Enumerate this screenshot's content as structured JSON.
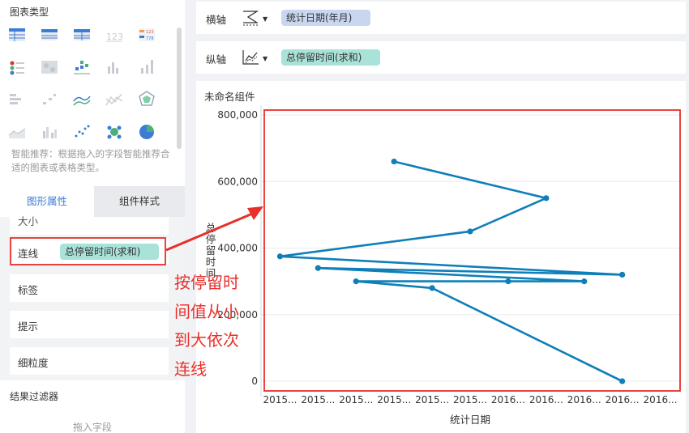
{
  "left_panel": {
    "chart_types_title": "图表类型",
    "chart_types": [
      "table-icon",
      "cross-table-icon",
      "detail-table-icon",
      "number-card-icon",
      "multi-number-icon",
      "indicator-card-icon",
      "heat-map-icon",
      "matrix-icon",
      "column-icon",
      "bar-icon",
      "stacked-bar-icon",
      "scatter-bar-icon",
      "line-icon",
      "area-line-icon",
      "radar-icon",
      "area-icon",
      "grouped-column-icon",
      "scatter-icon",
      "bubble-icon",
      "pie-icon"
    ],
    "hint": "智能推荐：根据拖入的字段智能推荐合适的图表或表格类型。",
    "tabs": [
      "图形属性",
      "组件样式"
    ],
    "size_label": "大小",
    "line_label": "连线",
    "line_field": "总停留时间(求和)",
    "label_label": "标签",
    "tip_label": "提示",
    "granularity_label": "细粒度",
    "filter_title": "结果过滤器",
    "drop_field": "拖入字段"
  },
  "axes": {
    "x_label": "横轴",
    "x_field": "统计日期(年月)",
    "y_label": "纵轴",
    "y_field": "总停留时间(求和)"
  },
  "widget_title": "未命名组件",
  "annotation": "按停留时间值从小到大依次连线",
  "colors": {
    "series": "#0e7fb8",
    "highlight": "#e8302a",
    "active_tab": "#3e7bd5",
    "x_pill": "#c8d6f0",
    "y_pill": "#a9e2d8"
  },
  "chart_data": {
    "type": "line",
    "xlabel": "统计日期",
    "ylabel": "总停留时间",
    "categories": [
      "2015...",
      "2015...",
      "2015...",
      "2015...",
      "2015...",
      "2015...",
      "2016...",
      "2016...",
      "2016...",
      "2016...",
      "2016..."
    ],
    "yticks": [
      "0",
      "200,000",
      "400,000",
      "600,000",
      "800,000"
    ],
    "ylim": [
      0,
      800000
    ],
    "grid": true,
    "points_in_connection_order": [
      {
        "x": 9.5,
        "y": 0
      },
      {
        "x": 4.5,
        "y": 280000
      },
      {
        "x": 2.5,
        "y": 300000
      },
      {
        "x": 6.5,
        "y": 300000
      },
      {
        "x": 8.5,
        "y": 300000
      },
      {
        "x": 1.5,
        "y": 340000
      },
      {
        "x": 9.5,
        "y": 320000
      },
      {
        "x": 0.5,
        "y": 375000
      },
      {
        "x": 5.5,
        "y": 450000
      },
      {
        "x": 7.5,
        "y": 550000
      },
      {
        "x": 3.5,
        "y": 660000
      }
    ]
  }
}
